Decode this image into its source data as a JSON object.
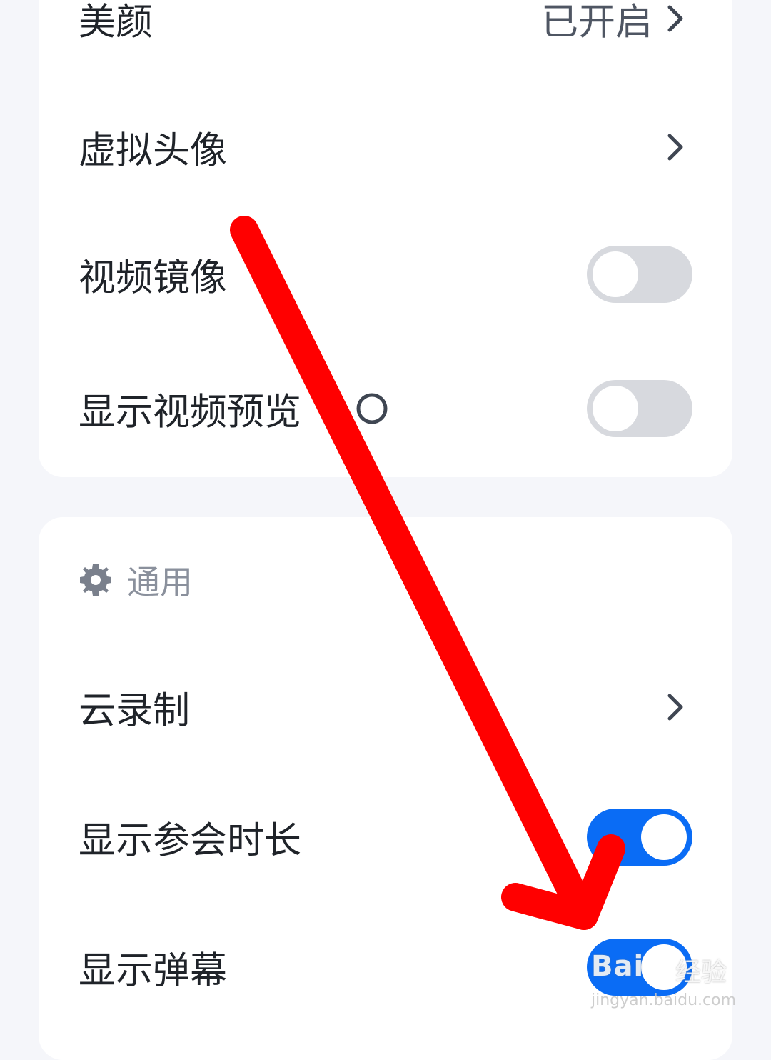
{
  "card1": {
    "beauty": {
      "label": "美颜",
      "value": "已开启"
    },
    "virtual_avatar": {
      "label": "虚拟头像"
    },
    "video_mirror": {
      "label": "视频镜像",
      "enabled": false
    },
    "show_video_preview": {
      "label": "显示视频预览",
      "enabled": false
    }
  },
  "card2": {
    "section_title": "通用",
    "section_icon": "gear-icon",
    "cloud_recording": {
      "label": "云录制"
    },
    "show_meeting_duration": {
      "label": "显示参会时长",
      "enabled": true
    },
    "show_danmaku": {
      "label": "显示弹幕",
      "enabled": true
    }
  },
  "annotation": {
    "type": "red-arrow",
    "color": "#ff0000"
  },
  "watermark": {
    "brand": "Bai",
    "brand_cn": "经验",
    "url": "jingyan.baidu.com"
  },
  "colors": {
    "toggle_on": "#0a6cf5",
    "toggle_off": "#d7d9de",
    "background": "#f5f6fa",
    "card": "#ffffff"
  }
}
